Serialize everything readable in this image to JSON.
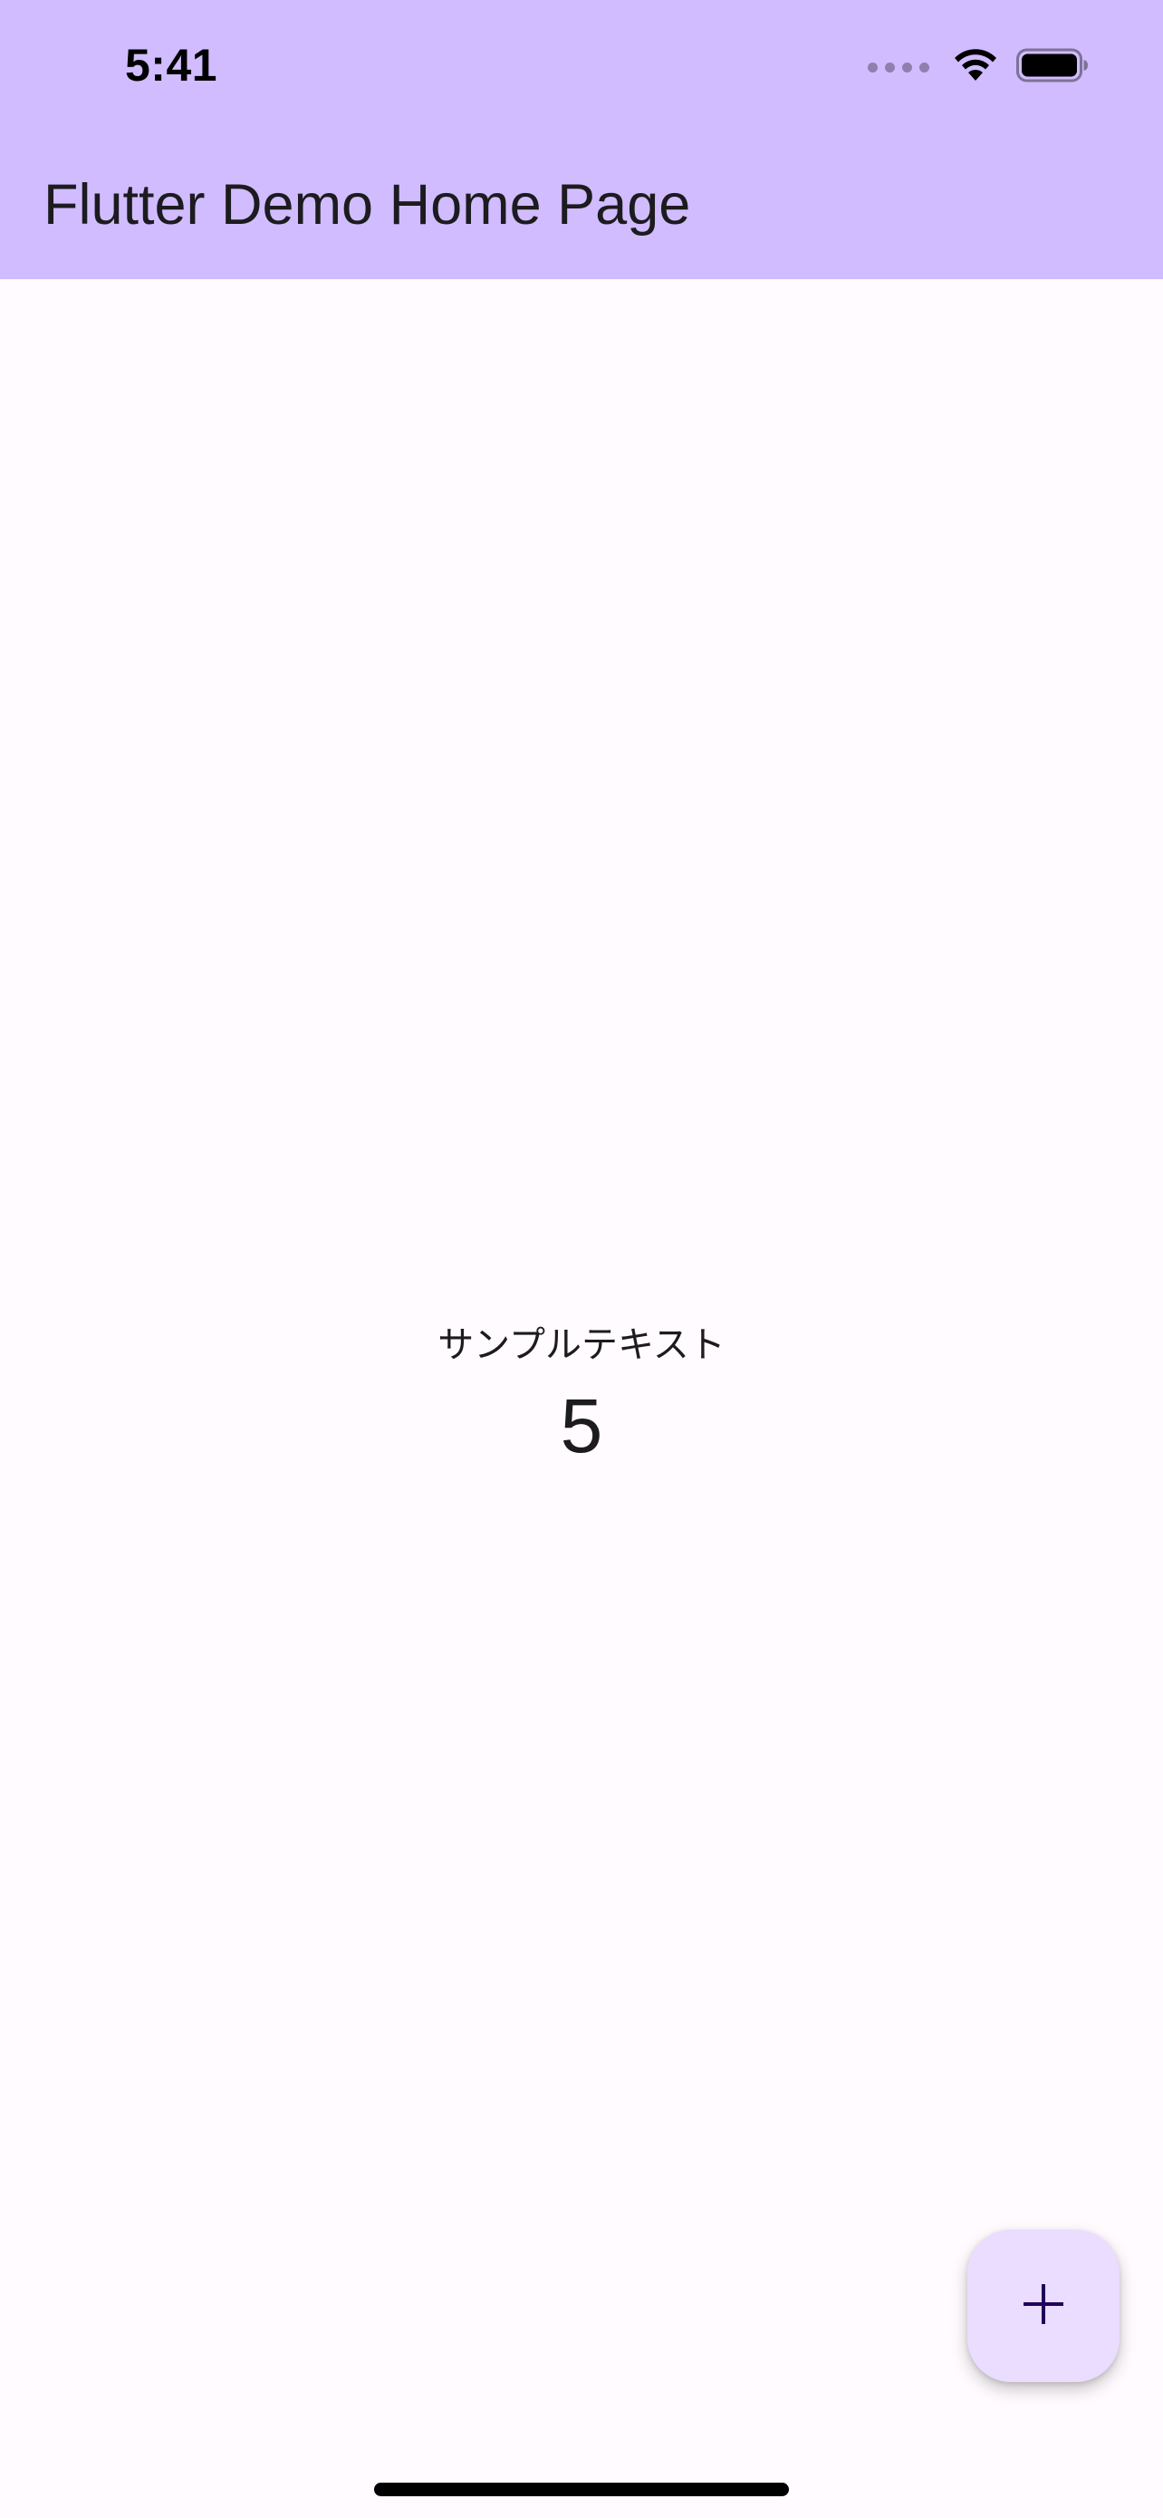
{
  "status_bar": {
    "time": "5:41",
    "icons": [
      "signal-dots-icon",
      "wifi-icon",
      "battery-icon"
    ]
  },
  "app_bar": {
    "title": "Flutter Demo Home Page"
  },
  "body": {
    "sample_text": "サンプルテキスト",
    "counter": "5"
  },
  "fab": {
    "icon": "plus-icon"
  },
  "colors": {
    "app_bar_background": "#d1bcff",
    "page_background": "#fffbfe",
    "fab_background": "#eaddff",
    "fab_icon": "#21005d",
    "text": "#1c1b1f"
  }
}
